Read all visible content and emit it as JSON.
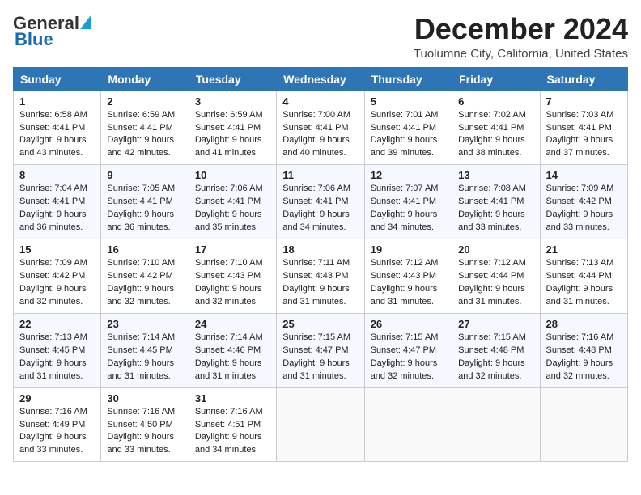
{
  "logo": {
    "general": "General",
    "blue": "Blue"
  },
  "title": {
    "month": "December 2024",
    "location": "Tuolumne City, California, United States"
  },
  "headers": [
    "Sunday",
    "Monday",
    "Tuesday",
    "Wednesday",
    "Thursday",
    "Friday",
    "Saturday"
  ],
  "weeks": [
    [
      {
        "day": "1",
        "sunrise": "6:58 AM",
        "sunset": "4:41 PM",
        "daylight": "9 hours and 43 minutes."
      },
      {
        "day": "2",
        "sunrise": "6:59 AM",
        "sunset": "4:41 PM",
        "daylight": "9 hours and 42 minutes."
      },
      {
        "day": "3",
        "sunrise": "6:59 AM",
        "sunset": "4:41 PM",
        "daylight": "9 hours and 41 minutes."
      },
      {
        "day": "4",
        "sunrise": "7:00 AM",
        "sunset": "4:41 PM",
        "daylight": "9 hours and 40 minutes."
      },
      {
        "day": "5",
        "sunrise": "7:01 AM",
        "sunset": "4:41 PM",
        "daylight": "9 hours and 39 minutes."
      },
      {
        "day": "6",
        "sunrise": "7:02 AM",
        "sunset": "4:41 PM",
        "daylight": "9 hours and 38 minutes."
      },
      {
        "day": "7",
        "sunrise": "7:03 AM",
        "sunset": "4:41 PM",
        "daylight": "9 hours and 37 minutes."
      }
    ],
    [
      {
        "day": "8",
        "sunrise": "7:04 AM",
        "sunset": "4:41 PM",
        "daylight": "9 hours and 36 minutes."
      },
      {
        "day": "9",
        "sunrise": "7:05 AM",
        "sunset": "4:41 PM",
        "daylight": "9 hours and 36 minutes."
      },
      {
        "day": "10",
        "sunrise": "7:06 AM",
        "sunset": "4:41 PM",
        "daylight": "9 hours and 35 minutes."
      },
      {
        "day": "11",
        "sunrise": "7:06 AM",
        "sunset": "4:41 PM",
        "daylight": "9 hours and 34 minutes."
      },
      {
        "day": "12",
        "sunrise": "7:07 AM",
        "sunset": "4:41 PM",
        "daylight": "9 hours and 34 minutes."
      },
      {
        "day": "13",
        "sunrise": "7:08 AM",
        "sunset": "4:41 PM",
        "daylight": "9 hours and 33 minutes."
      },
      {
        "day": "14",
        "sunrise": "7:09 AM",
        "sunset": "4:42 PM",
        "daylight": "9 hours and 33 minutes."
      }
    ],
    [
      {
        "day": "15",
        "sunrise": "7:09 AM",
        "sunset": "4:42 PM",
        "daylight": "9 hours and 32 minutes."
      },
      {
        "day": "16",
        "sunrise": "7:10 AM",
        "sunset": "4:42 PM",
        "daylight": "9 hours and 32 minutes."
      },
      {
        "day": "17",
        "sunrise": "7:10 AM",
        "sunset": "4:43 PM",
        "daylight": "9 hours and 32 minutes."
      },
      {
        "day": "18",
        "sunrise": "7:11 AM",
        "sunset": "4:43 PM",
        "daylight": "9 hours and 31 minutes."
      },
      {
        "day": "19",
        "sunrise": "7:12 AM",
        "sunset": "4:43 PM",
        "daylight": "9 hours and 31 minutes."
      },
      {
        "day": "20",
        "sunrise": "7:12 AM",
        "sunset": "4:44 PM",
        "daylight": "9 hours and 31 minutes."
      },
      {
        "day": "21",
        "sunrise": "7:13 AM",
        "sunset": "4:44 PM",
        "daylight": "9 hours and 31 minutes."
      }
    ],
    [
      {
        "day": "22",
        "sunrise": "7:13 AM",
        "sunset": "4:45 PM",
        "daylight": "9 hours and 31 minutes."
      },
      {
        "day": "23",
        "sunrise": "7:14 AM",
        "sunset": "4:45 PM",
        "daylight": "9 hours and 31 minutes."
      },
      {
        "day": "24",
        "sunrise": "7:14 AM",
        "sunset": "4:46 PM",
        "daylight": "9 hours and 31 minutes."
      },
      {
        "day": "25",
        "sunrise": "7:15 AM",
        "sunset": "4:47 PM",
        "daylight": "9 hours and 31 minutes."
      },
      {
        "day": "26",
        "sunrise": "7:15 AM",
        "sunset": "4:47 PM",
        "daylight": "9 hours and 32 minutes."
      },
      {
        "day": "27",
        "sunrise": "7:15 AM",
        "sunset": "4:48 PM",
        "daylight": "9 hours and 32 minutes."
      },
      {
        "day": "28",
        "sunrise": "7:16 AM",
        "sunset": "4:48 PM",
        "daylight": "9 hours and 32 minutes."
      }
    ],
    [
      {
        "day": "29",
        "sunrise": "7:16 AM",
        "sunset": "4:49 PM",
        "daylight": "9 hours and 33 minutes."
      },
      {
        "day": "30",
        "sunrise": "7:16 AM",
        "sunset": "4:50 PM",
        "daylight": "9 hours and 33 minutes."
      },
      {
        "day": "31",
        "sunrise": "7:16 AM",
        "sunset": "4:51 PM",
        "daylight": "9 hours and 34 minutes."
      },
      null,
      null,
      null,
      null
    ]
  ],
  "labels": {
    "sunrise": "Sunrise:",
    "sunset": "Sunset:",
    "daylight": "Daylight:"
  }
}
